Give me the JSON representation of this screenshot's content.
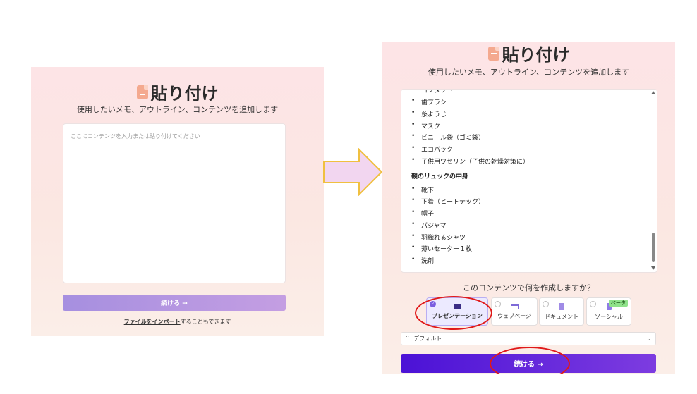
{
  "page": {
    "title": "貼り付け",
    "subtitle": "使用したいメモ、アウトライン、コンテンツを追加します"
  },
  "left": {
    "placeholder": "ここにコンテンツを入力または貼り付けてください",
    "continue_label": "続ける →",
    "import_link": "ファイルをインポート",
    "import_suffix": "することもできます"
  },
  "right": {
    "cut_item": "コンタクト",
    "items_a": [
      "歯ブラシ",
      "糸ようじ",
      "マスク",
      "ビニール袋（ゴミ袋）",
      "エコバック",
      "子供用ワセリン（子供の乾燥対策に）"
    ],
    "heading": "親のリュックの中身",
    "items_b": [
      "靴下",
      "下着（ヒートテック）",
      "帽子",
      "パジャマ",
      "羽織れるシャツ",
      "薄いセーター１枚",
      "洗剤"
    ],
    "question": "このコンテンツで何を作成しますか？",
    "options": [
      {
        "label": "プレゼンテーション",
        "icon": "presentation-icon",
        "selected": true
      },
      {
        "label": "ウェブページ",
        "icon": "webpage-icon",
        "selected": false
      },
      {
        "label": "ドキュメント",
        "icon": "document-icon",
        "selected": false
      },
      {
        "label": "ソーシャル",
        "icon": "social-icon",
        "selected": false,
        "badge": "ベータ"
      }
    ],
    "theme_select": "デフォルト",
    "continue_label": "続ける →"
  },
  "colors": {
    "accent_purple": "#6a2ad8",
    "left_button": "#b69be3",
    "annotation_red": "#e01919",
    "arrow_fill": "#f2d6f0",
    "arrow_stroke": "#f0c040"
  }
}
